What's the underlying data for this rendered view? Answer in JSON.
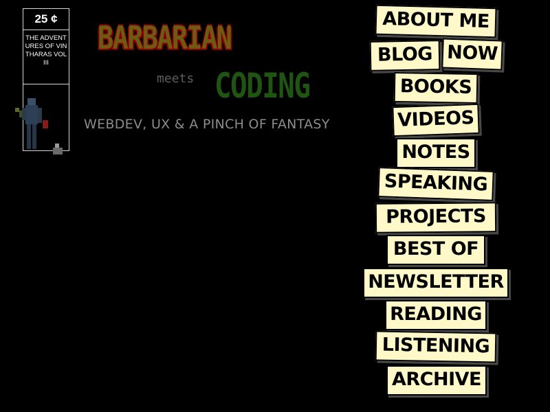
{
  "cover": {
    "price": "25 ¢",
    "caption": "THE ADVENTURES OF VINTHARAS VOL III"
  },
  "logo": {
    "barbarian": "BARBARIAN",
    "meets": "meets",
    "coding": "CODING"
  },
  "tagline": "WEBDEV, UX & A PINCH OF FANTASY",
  "nav": {
    "about": "ABOUT ME",
    "blog": "BLOG",
    "now": "NOW",
    "books": "BOOKS",
    "videos": "VIDEOS",
    "notes": "NOTES",
    "speaking": "SPEAKING",
    "projects": "PROJECTS",
    "bestof": "BEST OF",
    "newsletter": "NEWSLETTER",
    "reading": "READING",
    "listening": "LISTENING",
    "archive": "ARCHIVE"
  },
  "colors": {
    "background": "#000000",
    "card": "#fff8c8",
    "tagline": "#8c8c8c",
    "coding": "#1f5412",
    "barbarian": "#6e5a12"
  }
}
